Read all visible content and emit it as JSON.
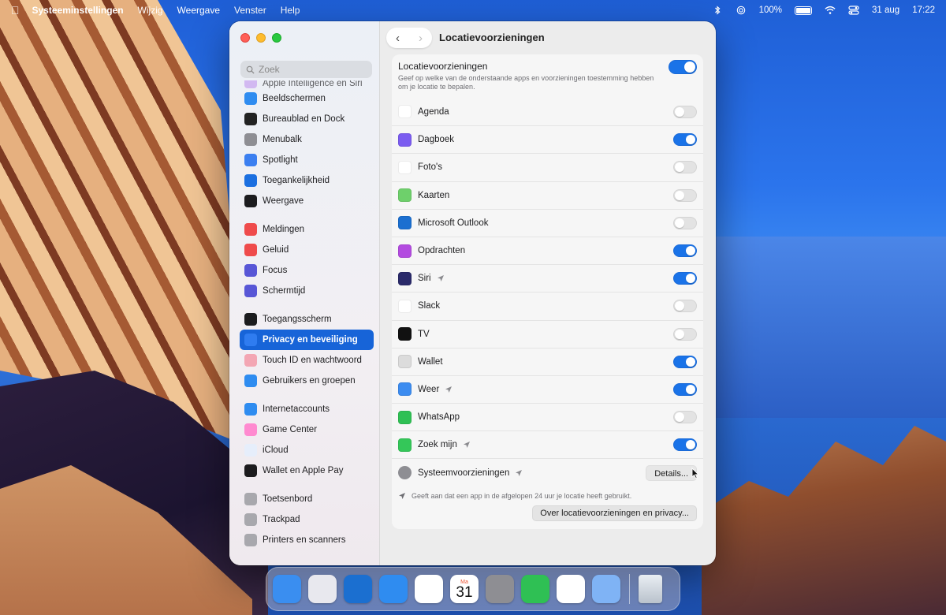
{
  "menubar": {
    "app_name": "Systeeminstellingen",
    "menus": [
      "Wijzig",
      "Weergave",
      "Venster",
      "Help"
    ],
    "battery": "100%",
    "date": "31 aug",
    "time": "17:22"
  },
  "window": {
    "title": "Locatievoorzieningen",
    "search_placeholder": "Zoek"
  },
  "sidebar": {
    "partial_item": "Apple Intelligence en Siri",
    "items": [
      {
        "label": "Beeldschermen",
        "icon": "display-icon",
        "color": "#2f8cf0"
      },
      {
        "label": "Bureaublad en Dock",
        "icon": "dock-icon",
        "color": "#222222"
      },
      {
        "label": "Menubalk",
        "icon": "menubar-icon",
        "color": "#8e8e93"
      },
      {
        "label": "Spotlight",
        "icon": "spotlight-icon",
        "color": "#3b7ff0"
      },
      {
        "label": "Toegankelijkheid",
        "icon": "accessibility-icon",
        "color": "#1b6fe0"
      },
      {
        "label": "Weergave",
        "icon": "appearance-icon",
        "color": "#1c1c1e"
      },
      {
        "label": "Meldingen",
        "icon": "notifications-icon",
        "color": "#ef4b4b"
      },
      {
        "label": "Geluid",
        "icon": "sound-icon",
        "color": "#ef4b4b"
      },
      {
        "label": "Focus",
        "icon": "focus-icon",
        "color": "#5856d6"
      },
      {
        "label": "Schermtijd",
        "icon": "screentime-icon",
        "color": "#5856d6"
      },
      {
        "label": "Toegangsscherm",
        "icon": "lockscreen-icon",
        "color": "#1c1c1e"
      },
      {
        "label": "Privacy en beveiliging",
        "icon": "privacy-hand-icon",
        "color": "#2f7cf0"
      },
      {
        "label": "Touch ID en wachtwoord",
        "icon": "touchid-icon",
        "color": "#f3a6b3"
      },
      {
        "label": "Gebruikers en groepen",
        "icon": "users-icon",
        "color": "#2f8cf0"
      },
      {
        "label": "Internetaccounts",
        "icon": "at-icon",
        "color": "#2f8cf0"
      },
      {
        "label": "Game Center",
        "icon": "gamecenter-icon",
        "color": "#ff8ad0"
      },
      {
        "label": "iCloud",
        "icon": "icloud-icon",
        "color": "#e6eefb"
      },
      {
        "label": "Wallet en Apple Pay",
        "icon": "wallet-icon",
        "color": "#1c1c1e"
      },
      {
        "label": "Toetsenbord",
        "icon": "keyboard-icon",
        "color": "#a8a8ad"
      },
      {
        "label": "Trackpad",
        "icon": "trackpad-icon",
        "color": "#a8a8ad"
      },
      {
        "label": "Printers en scanners",
        "icon": "printer-icon",
        "color": "#a8a8ad"
      }
    ],
    "selected": "Privacy en beveiliging"
  },
  "content": {
    "master_label": "Locatievoorzieningen",
    "master_desc": "Geef op welke van de onderstaande apps en voorzieningen toestemming hebben om je locatie te bepalen.",
    "master_on": true,
    "apps": [
      {
        "name": "Agenda",
        "icon": "calendar-icon",
        "color": "#ffffff",
        "on": false,
        "recent": false
      },
      {
        "name": "Dagboek",
        "icon": "journal-icon",
        "color": "#7b5cf0",
        "on": true,
        "recent": false
      },
      {
        "name": "Foto's",
        "icon": "photos-icon",
        "color": "#ffffff",
        "on": false,
        "recent": false
      },
      {
        "name": "Kaarten",
        "icon": "maps-icon",
        "color": "#6ed06b",
        "on": false,
        "recent": false
      },
      {
        "name": "Microsoft Outlook",
        "icon": "outlook-icon",
        "color": "#1b6fd0",
        "on": false,
        "recent": false
      },
      {
        "name": "Opdrachten",
        "icon": "shortcuts-icon",
        "color": "#b34be0",
        "on": true,
        "recent": false
      },
      {
        "name": "Siri",
        "icon": "siri-icon",
        "color": "#2a2a6a",
        "on": true,
        "recent": true
      },
      {
        "name": "Slack",
        "icon": "slack-icon",
        "color": "#ffffff",
        "on": false,
        "recent": false
      },
      {
        "name": "TV",
        "icon": "tv-icon",
        "color": "#111111",
        "on": false,
        "recent": false
      },
      {
        "name": "Wallet",
        "icon": "wallet-icon",
        "color": "#dcdcdc",
        "on": true,
        "recent": false
      },
      {
        "name": "Weer",
        "icon": "weather-icon",
        "color": "#3c8cf0",
        "on": true,
        "recent": true
      },
      {
        "name": "WhatsApp",
        "icon": "whatsapp-icon",
        "color": "#2fc054",
        "on": false,
        "recent": false
      },
      {
        "name": "Zoek mijn",
        "icon": "findmy-icon",
        "color": "#34c759",
        "on": true,
        "recent": true
      }
    ],
    "system_services": "Systeemvoorzieningen",
    "details_button": "Details...",
    "footnote": "Geeft aan dat een app in de afgelopen 24 uur je locatie heeft gebruikt.",
    "about_button": "Over locatievoorzieningen en privacy..."
  },
  "dock": {
    "apps": [
      {
        "name": "Finder",
        "icon": "finder-icon",
        "color": "#3a8ef0"
      },
      {
        "name": "Launchpad",
        "icon": "launchpad-icon",
        "color": "#e8e8ee"
      },
      {
        "name": "Outlook",
        "icon": "outlook-icon",
        "color": "#1b6fd0"
      },
      {
        "name": "Safari",
        "icon": "safari-icon",
        "color": "#2f8cf0"
      },
      {
        "name": "Foto's",
        "icon": "photos-icon",
        "color": "#ffffff"
      },
      {
        "name": "Agenda",
        "icon": "calendar-icon",
        "color": "#ffffff"
      },
      {
        "name": "Systeeminstellingen",
        "icon": "settings-icon",
        "color": "#8e8e93"
      },
      {
        "name": "WhatsApp",
        "icon": "whatsapp-icon",
        "color": "#2fc054"
      },
      {
        "name": "Slack",
        "icon": "slack-icon",
        "color": "#ffffff"
      },
      {
        "name": "Preview",
        "icon": "preview-icon",
        "color": "#7fb3f5"
      }
    ],
    "calendar_month": "Ma",
    "calendar_day": "31",
    "trash": "trash-icon"
  }
}
